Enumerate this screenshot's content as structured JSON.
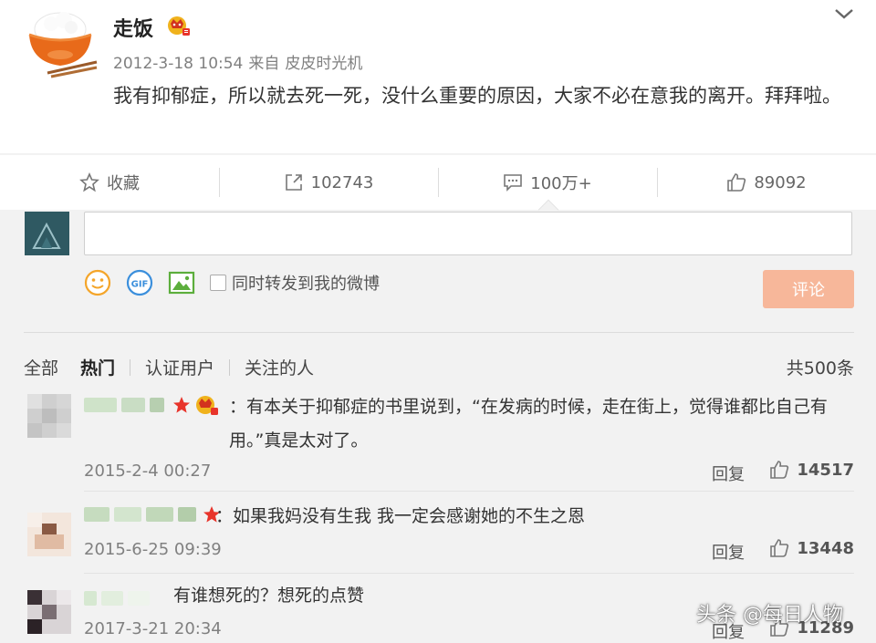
{
  "post": {
    "username": "走饭",
    "timestamp": "2012-3-18 10:54",
    "source_prefix": "来自",
    "source": "皮皮时光机",
    "text": "我有抑郁症，所以就去死一死，没什么重要的原因，大家不必在意我的离开。拜拜啦。"
  },
  "actions": {
    "favorite_label": "收藏",
    "repost_count": "102743",
    "comment_count": "100万+",
    "like_count": "89092"
  },
  "composer": {
    "input_value": "",
    "repost_checkbox_label": "同时转发到我的微博",
    "submit_label": "评论",
    "icons": [
      "emoji-icon",
      "gif-icon",
      "image-icon"
    ]
  },
  "tabs": {
    "items": [
      "全部",
      "热门",
      "认证用户",
      "关注的人"
    ],
    "active": "热门",
    "total": "共500条"
  },
  "comments": [
    {
      "text": "：有本关于抑郁症的书里说到，“在发病的时候，走在街上，觉得谁都比自己有用。”真是太对了。",
      "date": "2015-2-4 00:27",
      "reply_label": "回复",
      "likes": "14517"
    },
    {
      "text": "：如果我妈没有生我 我一定会感谢她的不生之恩",
      "date": "2015-6-25 09:39",
      "reply_label": "回复",
      "likes": "13448"
    },
    {
      "text": "有谁想死的？想死的点赞",
      "date": "2017-3-21 20:34",
      "reply_label": "回复",
      "likes": "11289"
    }
  ],
  "watermark": "头条 @每日人物",
  "colors": {
    "accent_button": "#f7b79a",
    "star_red": "#e8342b",
    "vip_gold": "#f0b21c"
  }
}
